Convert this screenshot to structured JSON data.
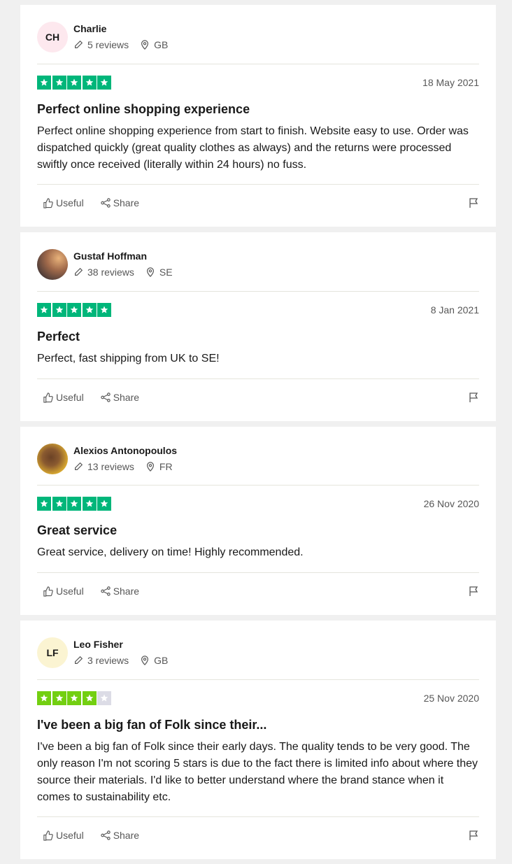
{
  "colors": {
    "five_star": "#00b67a",
    "four_star": "#73cf11",
    "empty_star": "#dcdce6"
  },
  "reviews": [
    {
      "initials": "CH",
      "avatar_bg": "#fde8ee",
      "name": "Charlie",
      "reviews_count": "5 reviews",
      "country": "GB",
      "rating": 5,
      "date": "18 May 2021",
      "title": "Perfect online shopping experience",
      "text": "Perfect online shopping experience from start to finish. Website easy to use. Order was dispatched quickly (great quality clothes as always) and the returns were processed swiftly once received (literally within 24 hours) no fuss.",
      "useful_label": "Useful",
      "share_label": "Share"
    },
    {
      "initials": "",
      "avatar_bg": "#7a5a48",
      "name": "Gustaf Hoffman",
      "reviews_count": "38 reviews",
      "country": "SE",
      "rating": 5,
      "date": "8 Jan 2021",
      "title": "Perfect",
      "text": "Perfect, fast shipping from UK to SE!",
      "useful_label": "Useful",
      "share_label": "Share"
    },
    {
      "initials": "",
      "avatar_bg": "#c28a4f",
      "name": "Alexios Antonopoulos",
      "reviews_count": "13 reviews",
      "country": "FR",
      "rating": 5,
      "date": "26 Nov 2020",
      "title": "Great service",
      "text": "Great service, delivery on time! Highly recommended.",
      "useful_label": "Useful",
      "share_label": "Share"
    },
    {
      "initials": "LF",
      "avatar_bg": "#fbf4d2",
      "name": "Leo Fisher",
      "reviews_count": "3 reviews",
      "country": "GB",
      "rating": 4,
      "date": "25 Nov 2020",
      "title": "I've been a big fan of Folk since their...",
      "text": "I've been a big fan of Folk since their early days. The quality tends to be very good. The only reason I'm not scoring 5 stars is due to the fact there is limited info about where they source their materials. I'd like to better understand where the brand stance when it comes to sustainability etc.",
      "useful_label": "Useful",
      "share_label": "Share"
    }
  ]
}
